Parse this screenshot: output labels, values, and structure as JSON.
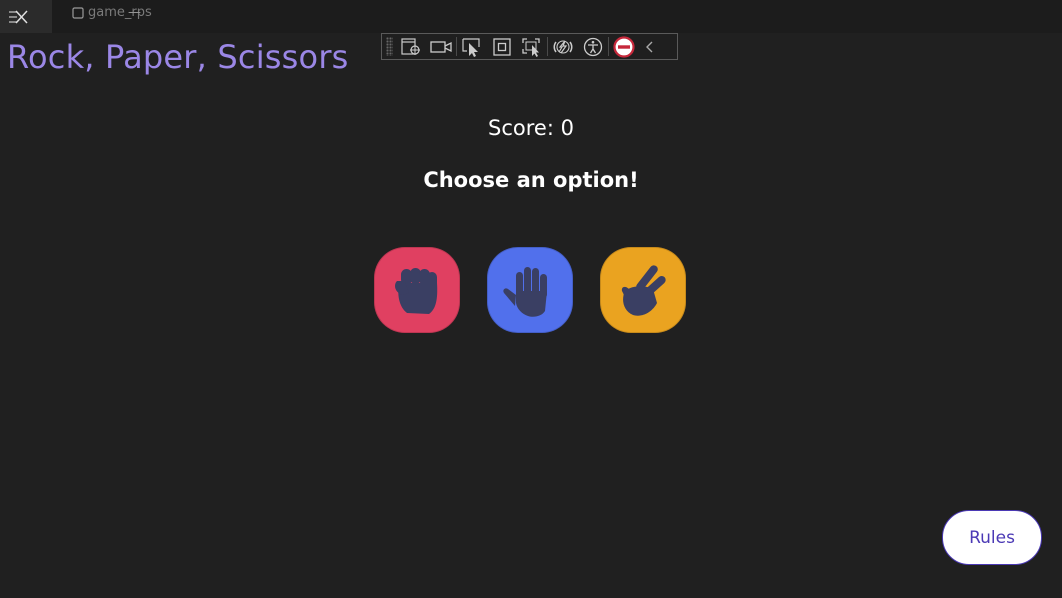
{
  "window": {
    "title": "game_rps",
    "minimize_glyph": "—"
  },
  "toolbar": {
    "icons": [
      "select-element-icon",
      "video-icon",
      "pointer-select-icon",
      "layout-adorner-icon",
      "track-focus-icon",
      "hot-reload-icon",
      "accessibility-icon",
      "stop-icon",
      "collapse-chevron-icon"
    ]
  },
  "game": {
    "title": "Rock, Paper, Scissors",
    "score_text": "Score: 0",
    "prompt": "Choose an option!",
    "choices": [
      {
        "name": "rock",
        "color": "#e04061"
      },
      {
        "name": "paper",
        "color": "#5170ec"
      },
      {
        "name": "scissors",
        "color": "#eaa320"
      }
    ],
    "hand_color": "#3a3f63"
  },
  "rules_button": {
    "label": "Rules",
    "accent": "#4b39b5"
  },
  "colors": {
    "background": "#202020",
    "title_accent": "#9b87e6"
  }
}
